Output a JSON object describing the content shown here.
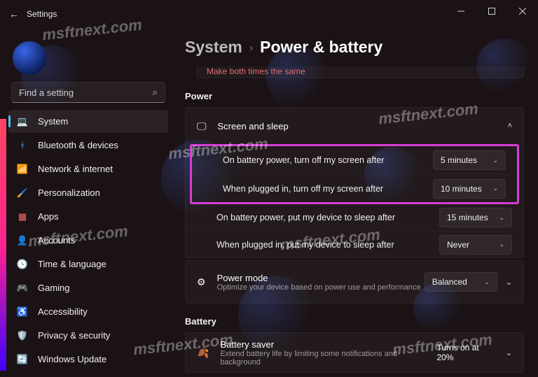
{
  "window": {
    "app_title": "Settings"
  },
  "search": {
    "placeholder": "Find a setting"
  },
  "nav": [
    {
      "key": "system",
      "label": "System",
      "icon": "💻",
      "selected": true
    },
    {
      "key": "bluetooth",
      "label": "Bluetooth & devices",
      "icon": "ᚼ",
      "selected": false
    },
    {
      "key": "network",
      "label": "Network & internet",
      "icon": "📶",
      "selected": false
    },
    {
      "key": "personalize",
      "label": "Personalization",
      "icon": "🖌️",
      "selected": false
    },
    {
      "key": "apps",
      "label": "Apps",
      "icon": "▦",
      "selected": false
    },
    {
      "key": "accounts",
      "label": "Accounts",
      "icon": "👤",
      "selected": false
    },
    {
      "key": "time",
      "label": "Time & language",
      "icon": "🕓",
      "selected": false
    },
    {
      "key": "gaming",
      "label": "Gaming",
      "icon": "🎮",
      "selected": false
    },
    {
      "key": "a11y",
      "label": "Accessibility",
      "icon": "♿",
      "selected": false
    },
    {
      "key": "privacy",
      "label": "Privacy & security",
      "icon": "🛡️",
      "selected": false
    },
    {
      "key": "update",
      "label": "Windows Update",
      "icon": "🔄",
      "selected": false
    }
  ],
  "breadcrumb": {
    "parent": "System",
    "current": "Power & battery"
  },
  "stub_card_text": "Make both times the same",
  "sections": {
    "power_label": "Power",
    "battery_label": "Battery"
  },
  "screen_sleep": {
    "title": "Screen and sleep",
    "rows": [
      {
        "label": "On battery power, turn off my screen after",
        "value": "5 minutes"
      },
      {
        "label": "When plugged in, turn off my screen after",
        "value": "10 minutes"
      },
      {
        "label": "On battery power, put my device to sleep after",
        "value": "15 minutes"
      },
      {
        "label": "When plugged in, put my device to sleep after",
        "value": "Never"
      }
    ]
  },
  "power_mode": {
    "title": "Power mode",
    "sub": "Optimize your device based on power use and performance",
    "value": "Balanced"
  },
  "battery_saver": {
    "title": "Battery saver",
    "sub": "Extend battery life by limiting some notifications and background",
    "value": "Turns on at 20%"
  },
  "watermark": "msftnext.com"
}
